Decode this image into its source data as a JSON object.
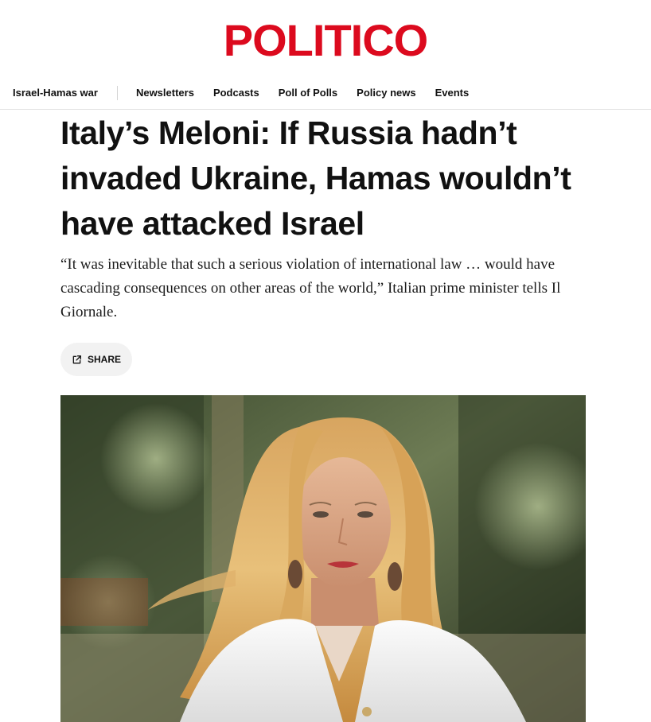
{
  "brand": {
    "logo_text": "POLITICO",
    "logo_color": "#dc0a1e"
  },
  "nav": {
    "items": [
      {
        "label": "Israel-Hamas war"
      },
      {
        "label": "Newsletters"
      },
      {
        "label": "Podcasts"
      },
      {
        "label": "Poll of Polls"
      },
      {
        "label": "Policy news"
      },
      {
        "label": "Events"
      }
    ]
  },
  "article": {
    "headline": "Italy’s Meloni: If Russia hadn’t invaded Ukraine, Hamas wouldn’t have attacked Israel",
    "dek": "“It was inevitable that such a serious violation of international law … would have cascading consequences on other areas of the world,” Italian prime minister tells Il Giornale.",
    "share_label": "SHARE",
    "share_icon": "external-share-icon",
    "hero_image_subject": "woman-with-blonde-hair-in-white-jacket-portrait"
  }
}
